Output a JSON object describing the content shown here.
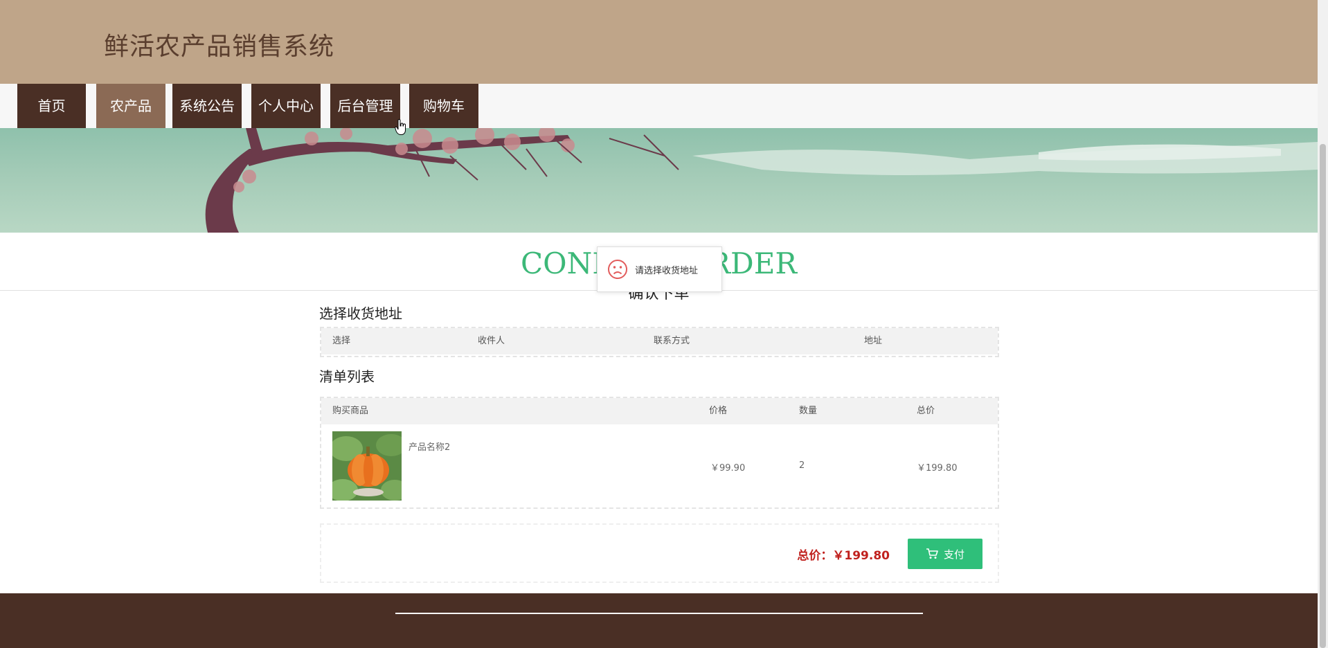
{
  "site": {
    "title": "鲜活农产品销售系统"
  },
  "nav": {
    "items": [
      {
        "label": "首页"
      },
      {
        "label": "农产品",
        "active": true
      },
      {
        "label": "系统公告"
      },
      {
        "label": "个人中心"
      },
      {
        "label": "后台管理"
      },
      {
        "label": "购物车"
      }
    ]
  },
  "page": {
    "heading": "CONFIRM ORDER",
    "subheading": "确认下单"
  },
  "toast": {
    "icon": "sad-face-icon",
    "message": "请选择收货地址"
  },
  "address": {
    "title": "选择收货地址",
    "columns": [
      "选择",
      "收件人",
      "联系方式",
      "地址"
    ]
  },
  "list": {
    "title": "清单列表",
    "columns": [
      "购买商品",
      "价格",
      "数量",
      "总价"
    ],
    "rows": [
      {
        "name": "产品名称2",
        "price": "￥99.90",
        "quantity": "2",
        "total": "￥199.80",
        "image": "pumpkin-image"
      }
    ]
  },
  "summary": {
    "total_label": "总价：",
    "total_value": "￥199.80",
    "pay_label": "支付",
    "pay_icon": "cart-icon"
  },
  "colors": {
    "header": "#bfa589",
    "nav": "#4a2f25",
    "nav_active": "#8b6a55",
    "accent": "#3cb878",
    "pay": "#2fbf7a",
    "total": "#c0211e",
    "footer": "#4a2f25"
  }
}
